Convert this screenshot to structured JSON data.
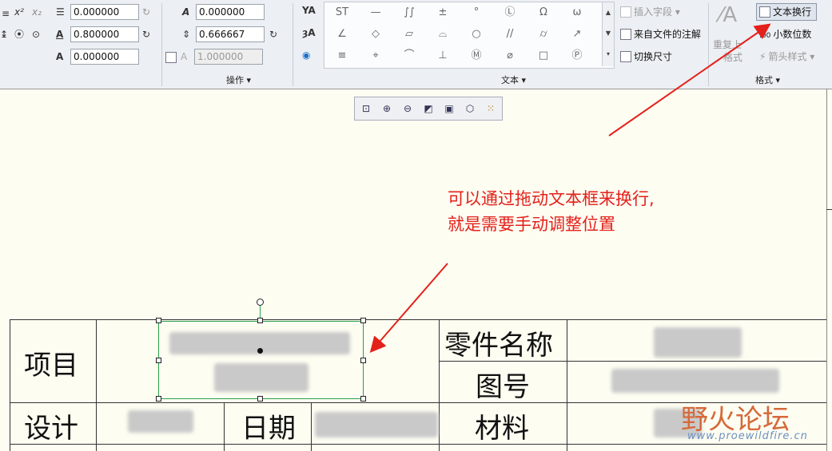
{
  "ribbon": {
    "format_fields": {
      "line_spacing_value": "0.000000",
      "width_factor_value": "0.800000",
      "slant_value": "0.000000",
      "text_height_value": "0.000000",
      "spacing_value": "0.666667",
      "char_space_value": "1.000000"
    },
    "labels": {
      "operations": "操作",
      "text": "文本",
      "format": "格式"
    },
    "symbols": [
      "ST",
      "—",
      "∫∫",
      "±",
      "°",
      "Ⓛ",
      "Ω",
      "ω",
      "∠",
      "◇",
      "▱",
      "⌓",
      "○",
      "//",
      "⌭",
      "↗",
      "≡",
      "⌖",
      "⌒",
      "⊥",
      "Ⓜ",
      "⌀",
      "□",
      "Ⓟ"
    ],
    "text_group": {
      "insert_field": "插入字段",
      "from_file_note": "来自文件的注解",
      "toggle_dimension": "切换尺寸"
    },
    "format_group": {
      "text_wrap": "文本换行",
      "decimal_places": "小数位数",
      "arrow_style": "箭头样式",
      "repeat_last_format": "重复上",
      "repeat_last_format_2": "格式"
    },
    "left_glyphs": {
      "superscript": "x²",
      "subscript": "x₂"
    }
  },
  "table": {
    "project": "项目",
    "part_name": "零件名称",
    "drawing_no": "图号",
    "design": "设计",
    "date": "日期",
    "material": "材料"
  },
  "annotation": {
    "line1": "可以通过拖动文本框来换行,",
    "line2": "就是需要手动调整位置"
  },
  "watermark": {
    "title": "野火论坛",
    "url": "www.proewildfire.cn"
  },
  "colors": {
    "annotation_red": "#e4201a",
    "selection_green": "#2aa14a",
    "canvas_bg": "#fdfdf2"
  }
}
